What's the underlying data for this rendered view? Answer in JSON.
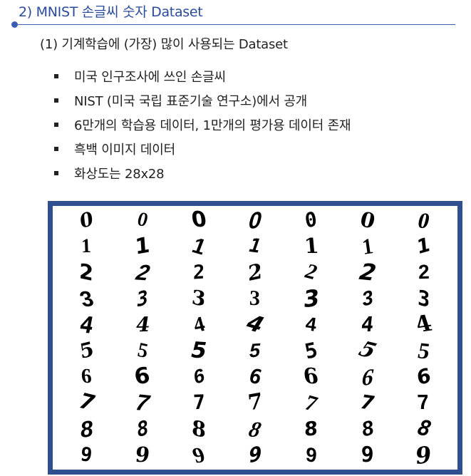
{
  "header": {
    "section_title": "2) MNIST 손글씨 숫자 Dataset"
  },
  "content": {
    "subheading": "(1) 기계학습에 (가장) 많이 사용되는 Dataset",
    "bullets": [
      "미국 인구조사에 쓰인 손글씨",
      "NIST (미국 국립 표준기술 연구소)에서 공개",
      "6만개의 학습용 데이터, 1만개의 평가용 데이터 존재",
      "흑백 이미지 데이터",
      "화상도는 28x28"
    ]
  },
  "digit_image": {
    "rows": [
      [
        "0",
        "0",
        "0",
        "0",
        "0",
        "0",
        "0"
      ],
      [
        "1",
        "1",
        "1",
        "1",
        "1",
        "1",
        "1"
      ],
      [
        "2",
        "2",
        "2",
        "2",
        "2",
        "2",
        "2"
      ],
      [
        "3",
        "3",
        "3",
        "3",
        "3",
        "3",
        "3"
      ],
      [
        "4",
        "4",
        "4",
        "4",
        "4",
        "4",
        "4"
      ],
      [
        "5",
        "5",
        "5",
        "5",
        "5",
        "5",
        "5"
      ],
      [
        "6",
        "6",
        "6",
        "6",
        "6",
        "6",
        "6"
      ],
      [
        "7",
        "7",
        "7",
        "7",
        "7",
        "7",
        "7"
      ],
      [
        "8",
        "8",
        "8",
        "8",
        "8",
        "8",
        "8"
      ],
      [
        "9",
        "9",
        "9",
        "9",
        "9",
        "9",
        "9"
      ]
    ],
    "frame_color": "#2f4f8f"
  },
  "colors": {
    "accent": "#2a4b9c",
    "rule": "#3a5fb3"
  }
}
